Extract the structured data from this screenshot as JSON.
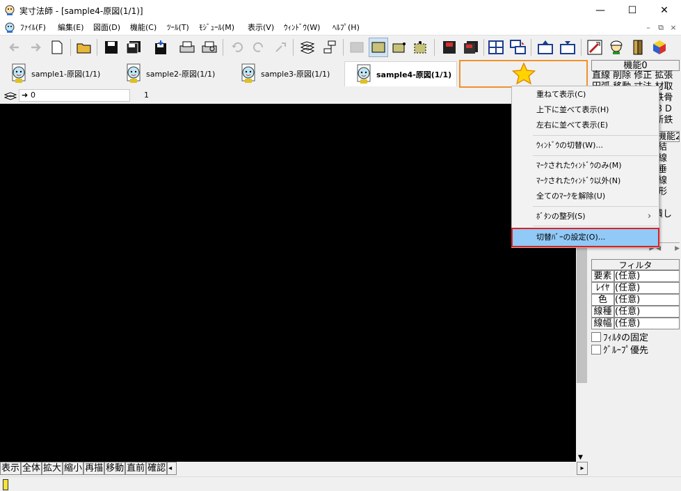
{
  "window": {
    "title": "実寸法師 - [sample4-原図(1/1)]",
    "minimize_glyph": "—",
    "maximize_glyph": "☐",
    "close_glyph": "✕",
    "mdi_min": "–",
    "mdi_restore": "⧉",
    "mdi_close": "×"
  },
  "menu": [
    "ﾌｧｲﾙ(F)",
    "編集(E)",
    "図面(D)",
    "機能(C)",
    "ﾂｰﾙ(T)",
    "ﾓｼﾞｭｰﾙ(M)",
    "表示(V)",
    "ｳｨﾝﾄﾞｳ(W)",
    "ﾍﾙﾌﾟ(H)"
  ],
  "toolbar": {
    "icons": [
      "back-arrow-icon",
      "forward-arrow-icon",
      "new-file-icon",
      "open-folder-icon",
      "save-icon",
      "save-all-icon",
      "save-as-icon",
      "print-icon",
      "print-preview-icon",
      "undo-icon",
      "redo-icon",
      "redo-alt-icon",
      "layers-icon",
      "align-icon",
      "grid-off-icon",
      "fill-rect-icon",
      "select-rect-icon",
      "select-dots-icon",
      "red-save-icon",
      "red-save-all-icon",
      "tile-windows-icon",
      "cascade-windows-icon",
      "arrange-up-icon",
      "arrange-down-icon",
      "measure-tool-icon",
      "worker-icon",
      "exit-door-icon",
      "color-cube-icon"
    ]
  },
  "tabs": [
    {
      "label": "sample1-原図(1/1)"
    },
    {
      "label": "sample2-原図(1/1)"
    },
    {
      "label": "sample3-原図(1/1)"
    },
    {
      "label": "sample4-原図(1/1)"
    }
  ],
  "star_glyph": "★",
  "layer": {
    "field": "0",
    "arrow": "➜",
    "page": "1"
  },
  "bottom_buttons": [
    "表示",
    "全体",
    "拡大",
    "縮小",
    "再描",
    "移動",
    "直前",
    "確認"
  ],
  "bottom_scroll": {
    "left": "◂",
    "right": "▸"
  },
  "right_panel": {
    "header": "機能0",
    "row1": "直線 削除 修正 拡張",
    "row2": "円弧 移動 寸法 材取",
    "row3": "文字 複写 寸入 鉄骨",
    "row4": "図形 回転 寸法 ３Ｄ",
    "row5": "作図 反転 一覧 新鉄",
    "header2": "機能2",
    "col_lines": [
      "結",
      "線",
      "垂",
      "線",
      "形",
      "",
      "潰し"
    ],
    "filter_header": "フィルタ",
    "filter_rows": [
      {
        "label": "要素",
        "value": "(任意)"
      },
      {
        "label": "ﾚｲﾔ",
        "value": "(任意)"
      },
      {
        "label": "色",
        "value": "(任意)"
      },
      {
        "label": "線種",
        "value": "(任意)"
      },
      {
        "label": "線幅",
        "value": "(任意)"
      }
    ],
    "checkbox1": "ﾌｨﾙﾀの固定",
    "checkbox2": "ｸﾞﾙｰﾌﾟ優先"
  },
  "context_menu": {
    "items": [
      "重ねて表示(C)",
      "上下に並べて表示(H)",
      "左右に並べて表示(E)",
      "ｳｨﾝﾄﾞｳの切替(W)...",
      "ﾏｰｸされたｳｨﾝﾄﾞｳのみ(M)",
      "ﾏｰｸされたｳｨﾝﾄﾞｳ以外(N)",
      "全てのﾏｰｸを解除(U)",
      "ﾎﾞﾀﾝの整列(S)",
      "切替ﾊﾞｰの設定(O)..."
    ],
    "submenu_arrow": "›"
  },
  "colors": {
    "highlight": "#91c9f7",
    "highlight_border": "#e02020",
    "star_border": "#f0902a",
    "star_fill": "#ffd400"
  }
}
